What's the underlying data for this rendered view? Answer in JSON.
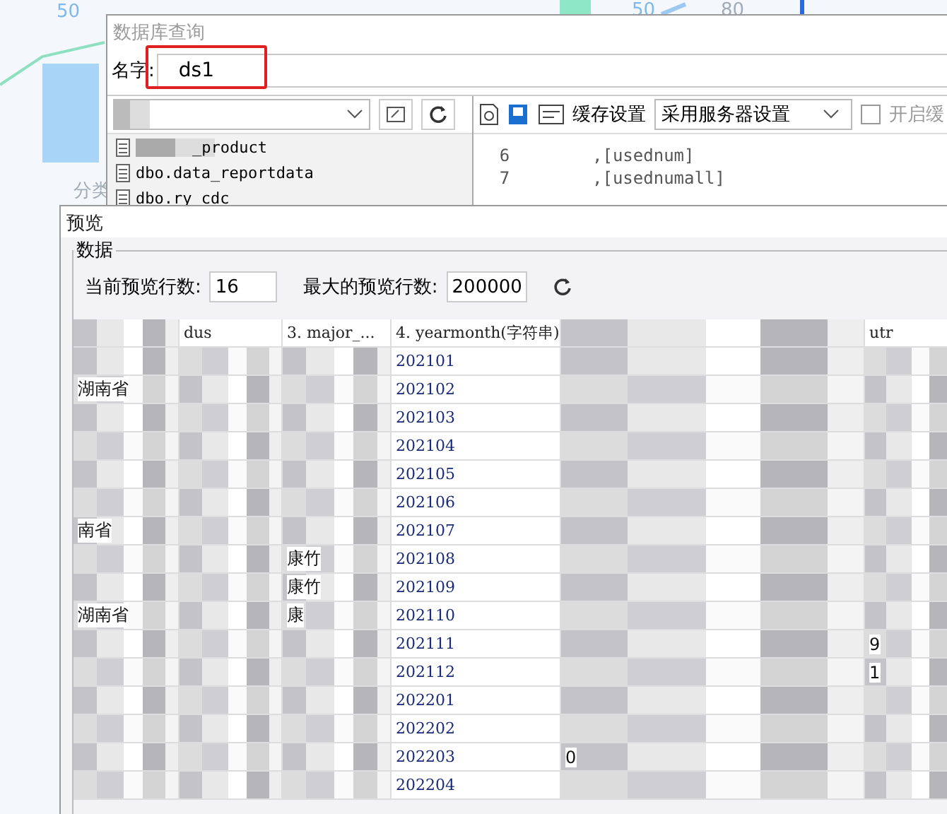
{
  "background_chart": {
    "labels": [
      {
        "text": "50",
        "kind": "axis"
      },
      {
        "text": "50",
        "kind": "value"
      },
      {
        "text": "80",
        "kind": "axis2"
      },
      {
        "text": "分类",
        "kind": "category"
      }
    ]
  },
  "query_dialog": {
    "title": "数据库查询",
    "name_label": "名字:",
    "name_value": "ds1",
    "cache_label": "缓存设置",
    "cache_select": "采用服务器设置",
    "cache_checkbox": {
      "label": "开启缓",
      "checked": false
    },
    "tables": [
      "_product",
      "dbo.data_reportdata",
      "dbo.ry_cdc"
    ],
    "code_lines": [
      {
        "number": "6",
        "text": ",[usednum]"
      },
      {
        "number": "7",
        "text": ",[usednumall]"
      }
    ]
  },
  "preview_dialog": {
    "title": "预览",
    "group": "数据",
    "current_rows_label": "当前预览行数:",
    "current_rows": "16",
    "max_rows_label": "最大的预览行数:",
    "max_rows": "200000",
    "columns": [
      {
        "kind": "blurred"
      },
      {
        "kind": "label",
        "label": "dus"
      },
      {
        "kind": "label",
        "label": "3. major_..."
      },
      {
        "kind": "label",
        "label": "4. yearmonth(字符串)"
      },
      {
        "kind": "blurred"
      },
      {
        "kind": "label",
        "label": "utr"
      }
    ],
    "rows": [
      {
        "yearmonth": "202101"
      },
      {
        "yearmonth": "202102",
        "column_1": "湖南省"
      },
      {
        "yearmonth": "202103"
      },
      {
        "yearmonth": "202104"
      },
      {
        "yearmonth": "202105"
      },
      {
        "yearmonth": "202106"
      },
      {
        "yearmonth": "202107",
        "column_1": "南省"
      },
      {
        "yearmonth": "202108",
        "column_3": "康竹"
      },
      {
        "yearmonth": "202109",
        "column_3": "康竹"
      },
      {
        "yearmonth": "202110",
        "column_1": "湖南省",
        "column_3": "康"
      },
      {
        "yearmonth": "202111",
        "column_6": "9"
      },
      {
        "yearmonth": "202112",
        "column_6": "1"
      },
      {
        "yearmonth": "202201"
      },
      {
        "yearmonth": "202202"
      },
      {
        "yearmonth": "202203",
        "column_5": "0"
      },
      {
        "yearmonth": "202204"
      }
    ]
  }
}
